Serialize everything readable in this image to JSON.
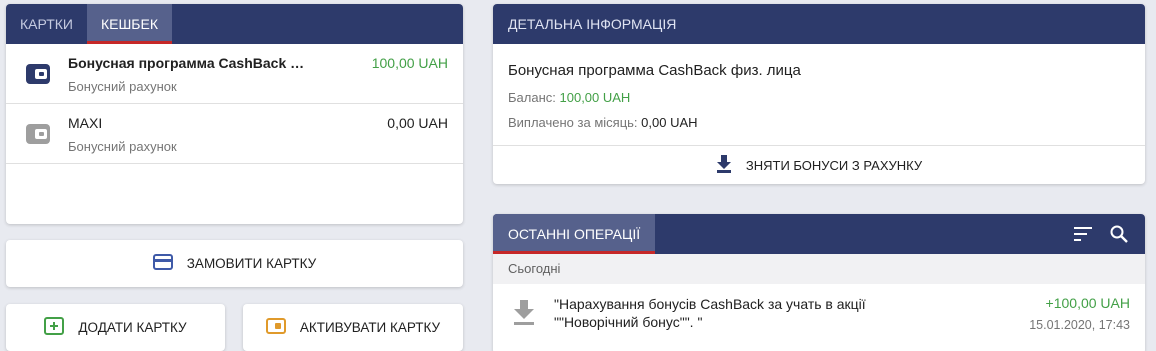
{
  "tabs": {
    "cards": "Картки",
    "cashback": "Кешбек"
  },
  "accounts": [
    {
      "name": "Бонусная программа CashBack физ. лица",
      "subtitle": "Бонусний рахунок",
      "amount": "100,00 UAH",
      "amount_color": "#43a047",
      "icon": "wallet-icon",
      "icon_color": "#2d3a6b"
    },
    {
      "name": "MAXI",
      "subtitle": "Бонусний рахунок",
      "amount": "0,00 UAH",
      "amount_color": "#212121",
      "icon": "wallet-icon",
      "icon_color": "#9e9e9e"
    }
  ],
  "actions": {
    "order_card": "Замовити картку",
    "add_card": "Додати картку",
    "activate_card": "Активувати картку"
  },
  "detail": {
    "header": "Детальна інформація",
    "title": "Бонусная программа CashBack физ. лица",
    "balance_label": "Баланс:",
    "balance_value": "100,00 UAH",
    "paid_label": "Виплачено за місяць:",
    "paid_value": "0,00 UAH",
    "withdraw_label": "Зняти бонуси з рахунку"
  },
  "operations": {
    "header": "Останні операції",
    "group_label": "Сьогодні",
    "items": [
      {
        "description": "\"Нарахування бонусів CashBack за учать в акції \"\"Новорічний бонус\"\". \"",
        "amount": "+100,00 UAH",
        "datetime": "15.01.2020, 17:43",
        "icon": "download-icon"
      }
    ]
  },
  "colors": {
    "navy": "#2d3a6b",
    "tab_active": "#56618c",
    "accent_red": "#c62828",
    "green": "#43a047",
    "page_bg": "#e8eaf0",
    "add_icon": "#43a047",
    "activate_icon": "#e09a2b"
  }
}
